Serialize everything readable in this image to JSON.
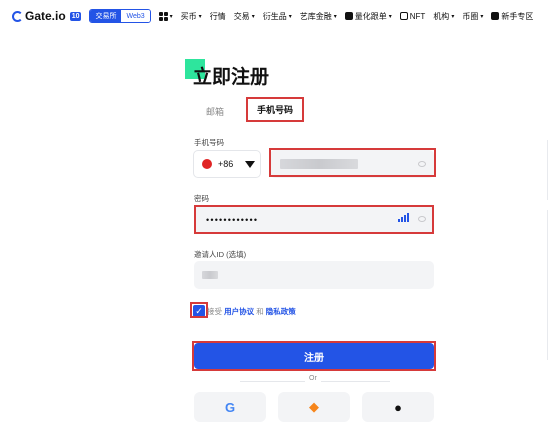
{
  "nav": {
    "brand": "Gate.io",
    "brand_badge": "10",
    "mode_exchange": "交易所",
    "mode_web3": "Web3",
    "items": [
      {
        "label": "买币",
        "caret": true
      },
      {
        "label": "行情",
        "caret": false
      },
      {
        "label": "交易",
        "caret": true
      },
      {
        "label": "衍生品",
        "caret": true
      },
      {
        "label": "艺库金融",
        "caret": true
      },
      {
        "label": "量化跟单",
        "caret": true
      },
      {
        "label": "NFT",
        "caret": false
      },
      {
        "label": "机构",
        "caret": true
      },
      {
        "label": "币圈",
        "caret": true
      },
      {
        "label": "新手专区",
        "caret": false
      }
    ]
  },
  "form": {
    "title": "立即注册",
    "tabs": {
      "email": "邮箱",
      "phone": "手机号码"
    },
    "phone_label": "手机号码",
    "country_code": "+86",
    "password_label": "密码",
    "password_mask": "••••••••••••",
    "invite_label": "邀请人ID (选填)",
    "agree_prefix": "接受",
    "agree_terms": "用户协议",
    "agree_and": "和",
    "agree_privacy": "隐私政策",
    "submit_label": "注册",
    "or_label": "Or",
    "checkbox_checked": true
  },
  "colors": {
    "accent": "#2354e6",
    "annotation": "#d63a3a",
    "deco": "#2ee59d"
  },
  "icons": {
    "google": "google-icon",
    "metamask": "metamask-icon",
    "apple": "apple-icon"
  }
}
